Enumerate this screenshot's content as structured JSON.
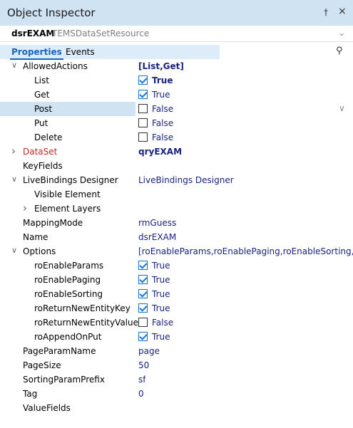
{
  "window": {
    "title": "Object Inspector",
    "pin_glyph": "†",
    "close_glyph": "×"
  },
  "object_selector": {
    "name": "dsrEXAM",
    "type": "TEMSDataSetResource"
  },
  "tabs": [
    {
      "label": "Properties",
      "active": true
    },
    {
      "label": "Events",
      "active": false
    }
  ],
  "search": {
    "icon": "search-icon",
    "placeholder": ""
  },
  "properties": [
    {
      "name": "AllowedActions",
      "value": "[List,Get]",
      "expander": "open",
      "bold": true
    },
    {
      "name": "List",
      "type": "checkbox",
      "checked": true,
      "value": "True",
      "bold": true
    },
    {
      "name": "Get",
      "type": "checkbox",
      "checked": true,
      "value": "True"
    },
    {
      "name": "Post",
      "type": "checkbox",
      "checked": false,
      "value": "False",
      "selected": true
    },
    {
      "name": "Put",
      "type": "checkbox",
      "checked": false,
      "value": "False"
    },
    {
      "name": "Delete",
      "type": "checkbox",
      "checked": false,
      "value": "False"
    },
    {
      "name": "DataSet",
      "value": "qryEXAM",
      "expander": "closed",
      "red": true,
      "bold": true
    },
    {
      "name": "KeyFields",
      "value": ""
    },
    {
      "name": "LiveBindings Designer",
      "value": "LiveBindings Designer",
      "expander": "open"
    },
    {
      "name": "Visible Element",
      "value": ""
    },
    {
      "name": "Element Layers",
      "value": "",
      "expander": "closed"
    },
    {
      "name": "MappingMode",
      "value": "rmGuess"
    },
    {
      "name": "Name",
      "value": "dsrEXAM"
    },
    {
      "name": "Options",
      "value": "[roEnableParams,roEnablePaging,roEnableSorting,roReturnNewEntityKey,roAppendOnPut]",
      "expander": "open"
    },
    {
      "name": "roEnableParams",
      "type": "checkbox",
      "checked": true,
      "value": "True"
    },
    {
      "name": "roEnablePaging",
      "type": "checkbox",
      "checked": true,
      "value": "True"
    },
    {
      "name": "roEnableSorting",
      "type": "checkbox",
      "checked": true,
      "value": "True"
    },
    {
      "name": "roReturnNewEntityKey",
      "type": "checkbox",
      "checked": true,
      "value": "True"
    },
    {
      "name": "roReturnNewEntityValue",
      "type": "checkbox",
      "checked": false,
      "value": "False"
    },
    {
      "name": "roAppendOnPut",
      "type": "checkbox",
      "checked": true,
      "value": "True"
    },
    {
      "name": "PageParamName",
      "value": "page"
    },
    {
      "name": "PageSize",
      "value": "50"
    },
    {
      "name": "SortingParamPrefix",
      "value": "sf"
    },
    {
      "name": "Tag",
      "value": "0"
    },
    {
      "name": "ValueFields",
      "value": ""
    }
  ],
  "colors": {
    "accent": "#1565c0",
    "title_bar": "#cfe3f3",
    "value_text": "#1a237e",
    "reference_text": "#c62828"
  }
}
